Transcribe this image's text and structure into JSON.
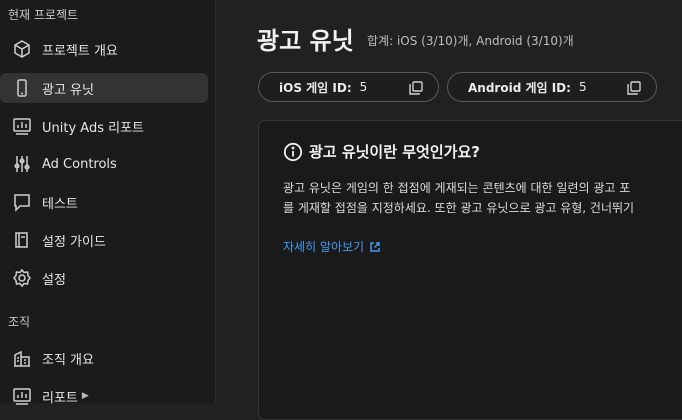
{
  "sidebar": {
    "current_project_title": "현재 프로젝트",
    "org_title": "조직",
    "items": [
      {
        "label": "프로젝트 개요",
        "icon": "cube-icon"
      },
      {
        "label": "광고 유닛",
        "icon": "phone-icon"
      },
      {
        "label": "Unity Ads 리포트",
        "icon": "report-chart-icon"
      },
      {
        "label": "Ad Controls",
        "icon": "sliders-icon"
      },
      {
        "label": "테스트",
        "icon": "test-icon"
      },
      {
        "label": "설정 가이드",
        "icon": "book-icon"
      },
      {
        "label": "설정",
        "icon": "gear-icon"
      },
      {
        "label": "조직 개요",
        "icon": "building-icon"
      },
      {
        "label": "리포트",
        "icon": "report-chart-icon"
      }
    ]
  },
  "header": {
    "title": "광고 유닛",
    "subtitle": "합계: iOS (3/10)개, Android (3/10)개"
  },
  "game_ids": {
    "ios_label": "iOS 게임 ID:",
    "ios_value": "5",
    "android_label": "Android 게임 ID:",
    "android_value": "5"
  },
  "info_card": {
    "title": "광고 유닛이란 무엇인가요?",
    "line1": "광고 유닛은 게임의 한 접점에 게재되는 콘텐츠에 대한 일련의 광고 포",
    "line2": "를 게재할 접점을 지정하세요. 또한 광고 유닛으로 광고 유형, 건너뛰기",
    "link": "자세히 알아보기"
  },
  "colors": {
    "accent_link": "#3f9cf0",
    "active_item_bg": "#333333"
  }
}
